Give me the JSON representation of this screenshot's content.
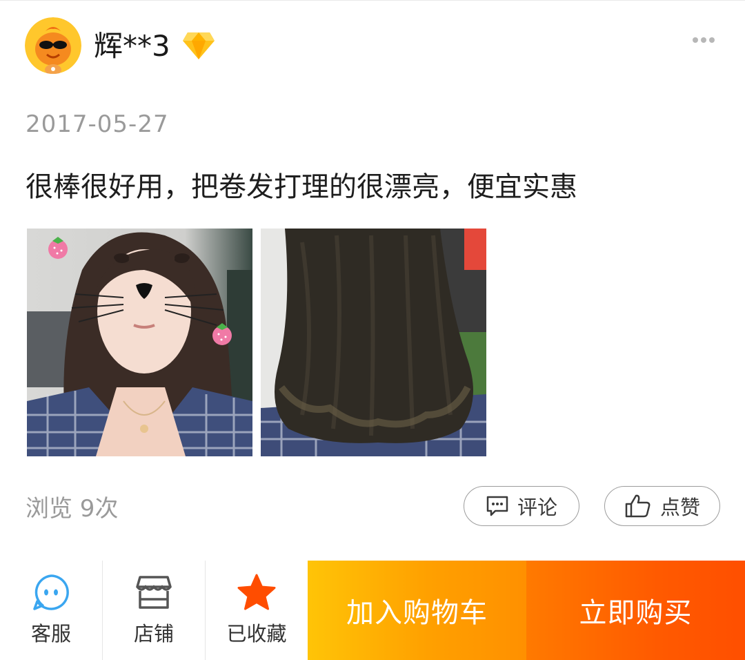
{
  "review": {
    "username": "辉**3",
    "date": "2017-05-27",
    "text": "很棒很好用，把卷发打理的很漂亮，便宜实惠",
    "views": "浏览 9次",
    "comment_label": "评论",
    "like_label": "点赞"
  },
  "bottom_bar": {
    "service_label": "客服",
    "shop_label": "店铺",
    "favorite_label": "已收藏",
    "add_to_cart_label": "加入购物车",
    "buy_now_label": "立即购买"
  },
  "icons": {
    "avatar": "cartoon-avatar-icon",
    "vip": "diamond-icon",
    "more": "more-dots-icon",
    "comment": "comment-icon",
    "like": "thumbs-up-icon",
    "service": "chat-bubble-face-icon",
    "shop": "shop-icon",
    "favorite": "star-icon"
  },
  "colors": {
    "accent_orange": "#ff9000",
    "buy_red_orange": "#ff5000",
    "favorite_star": "#ff4d00",
    "service_blue": "#3aa6f0",
    "muted_text": "#9a9a9a"
  }
}
